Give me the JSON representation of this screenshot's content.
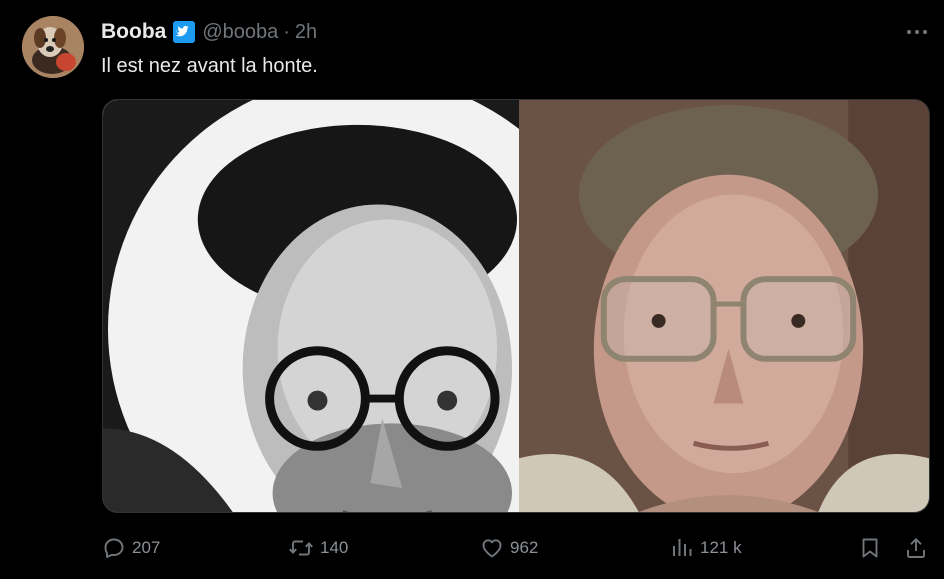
{
  "tweet": {
    "display_name": "Booba",
    "handle": "@booba",
    "separator": "·",
    "time": "2h",
    "text": "Il est nez avant la honte.",
    "verified_badge_color": "#1d9bf0",
    "avatar_icon": "dog-avatar-icon",
    "more_icon": "more-dots-icon"
  },
  "media": {
    "images": [
      {
        "name": "left-photo",
        "style": "black-and-white portrait"
      },
      {
        "name": "right-photo",
        "style": "color portrait"
      }
    ]
  },
  "actions": {
    "reply": {
      "icon": "reply-icon",
      "count": "207"
    },
    "retweet": {
      "icon": "retweet-icon",
      "count": "140"
    },
    "like": {
      "icon": "heart-icon",
      "count": "962"
    },
    "views": {
      "icon": "views-icon",
      "count": "121 k"
    },
    "bookmark": {
      "icon": "bookmark-icon"
    },
    "share": {
      "icon": "share-icon"
    }
  },
  "colors": {
    "background": "#000000",
    "text_primary": "#e7e9ea",
    "text_secondary": "#71767b",
    "accent": "#1d9bf0"
  }
}
